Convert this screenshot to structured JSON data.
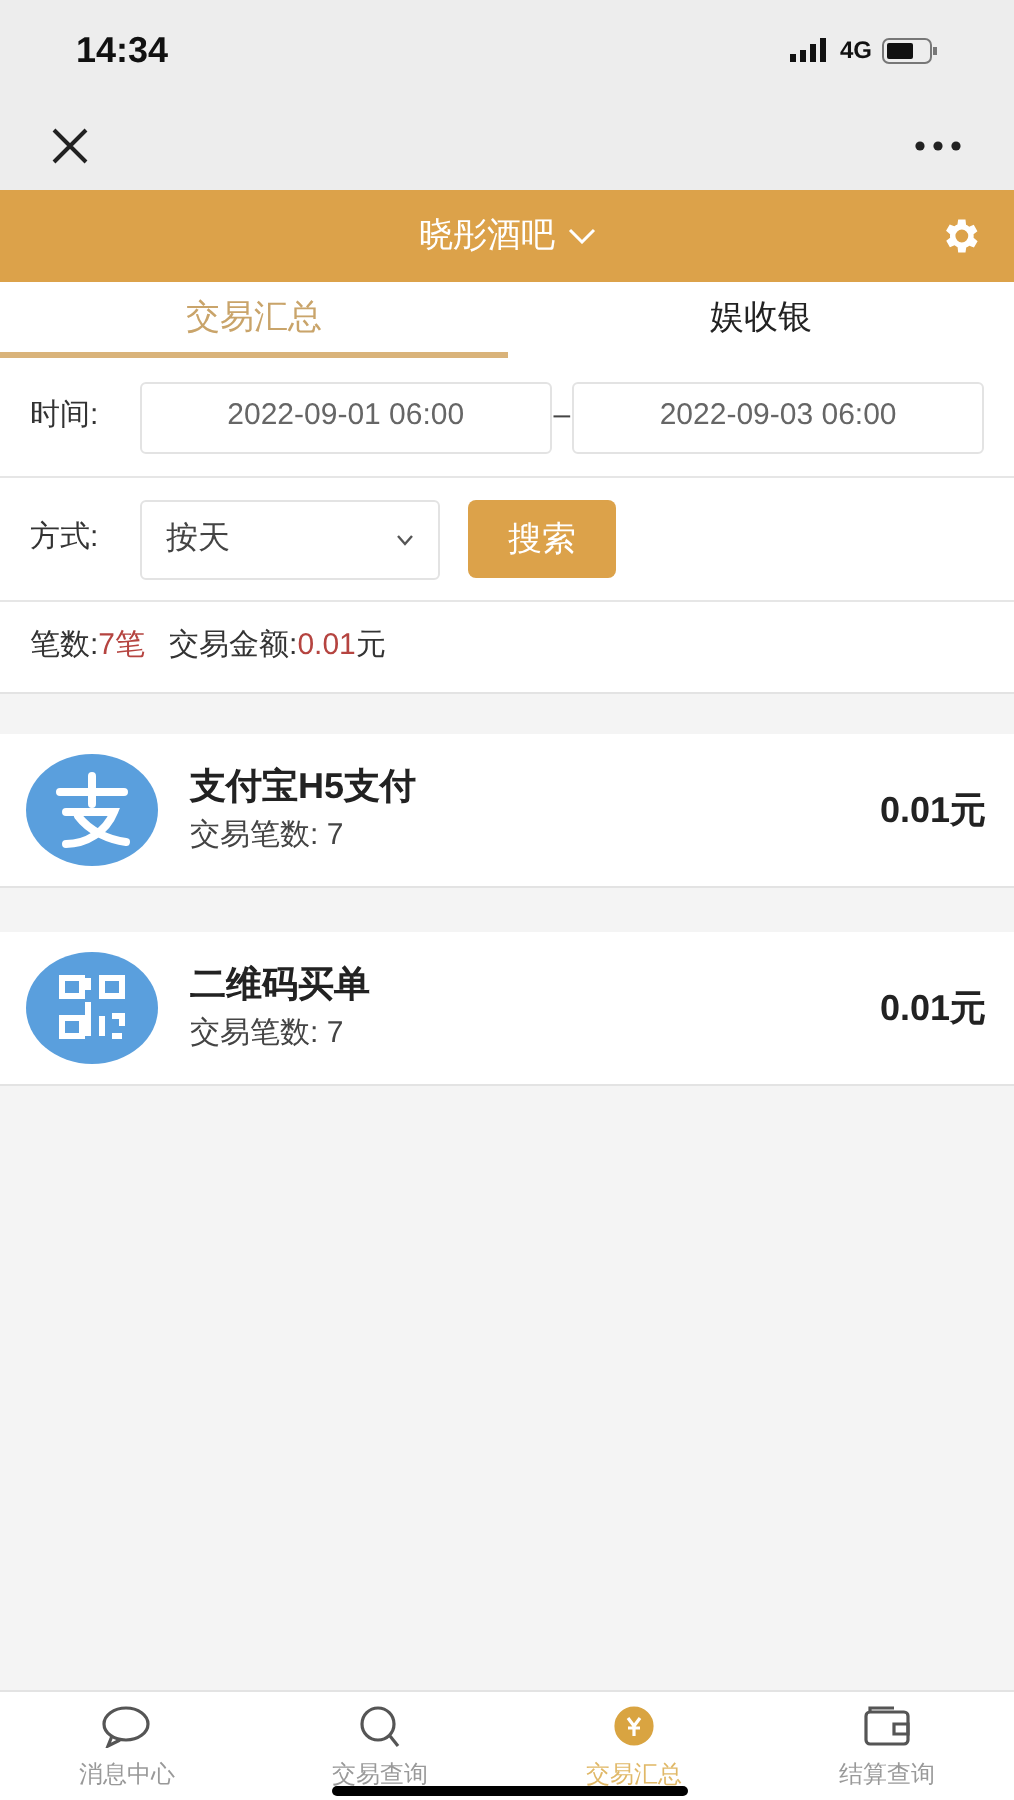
{
  "status_bar": {
    "time": "14:34",
    "network": "4G"
  },
  "header": {
    "title": "晓彤酒吧"
  },
  "tabs": [
    {
      "label": "交易汇总",
      "selected": true
    },
    {
      "label": "娱收银",
      "selected": false
    }
  ],
  "filters": {
    "time_label": "时间:",
    "start": "2022-09-01 06:00",
    "separator": "–",
    "end": "2022-09-03 06:00",
    "mode_label": "方式:",
    "mode_value": "按天",
    "search_button": "搜索"
  },
  "summary": {
    "count_label": "笔数:",
    "count": "7笔",
    "amount_label": "交易金额:",
    "amount": "0.01",
    "amount_unit": "元"
  },
  "payments": [
    {
      "kind": "alipay",
      "name": "支付宝H5支付",
      "count_text": "交易笔数: 7",
      "amount": "0.01元"
    },
    {
      "kind": "qrcode",
      "name": "二维码买单",
      "count_text": "交易笔数: 7",
      "amount": "0.01元"
    }
  ],
  "bottom_nav": [
    {
      "kind": "message",
      "label": "消息中心",
      "selected": false
    },
    {
      "kind": "search",
      "label": "交易查询",
      "selected": false
    },
    {
      "kind": "summary",
      "label": "交易汇总",
      "selected": true
    },
    {
      "kind": "wallet",
      "label": "结算查询",
      "selected": false
    }
  ]
}
